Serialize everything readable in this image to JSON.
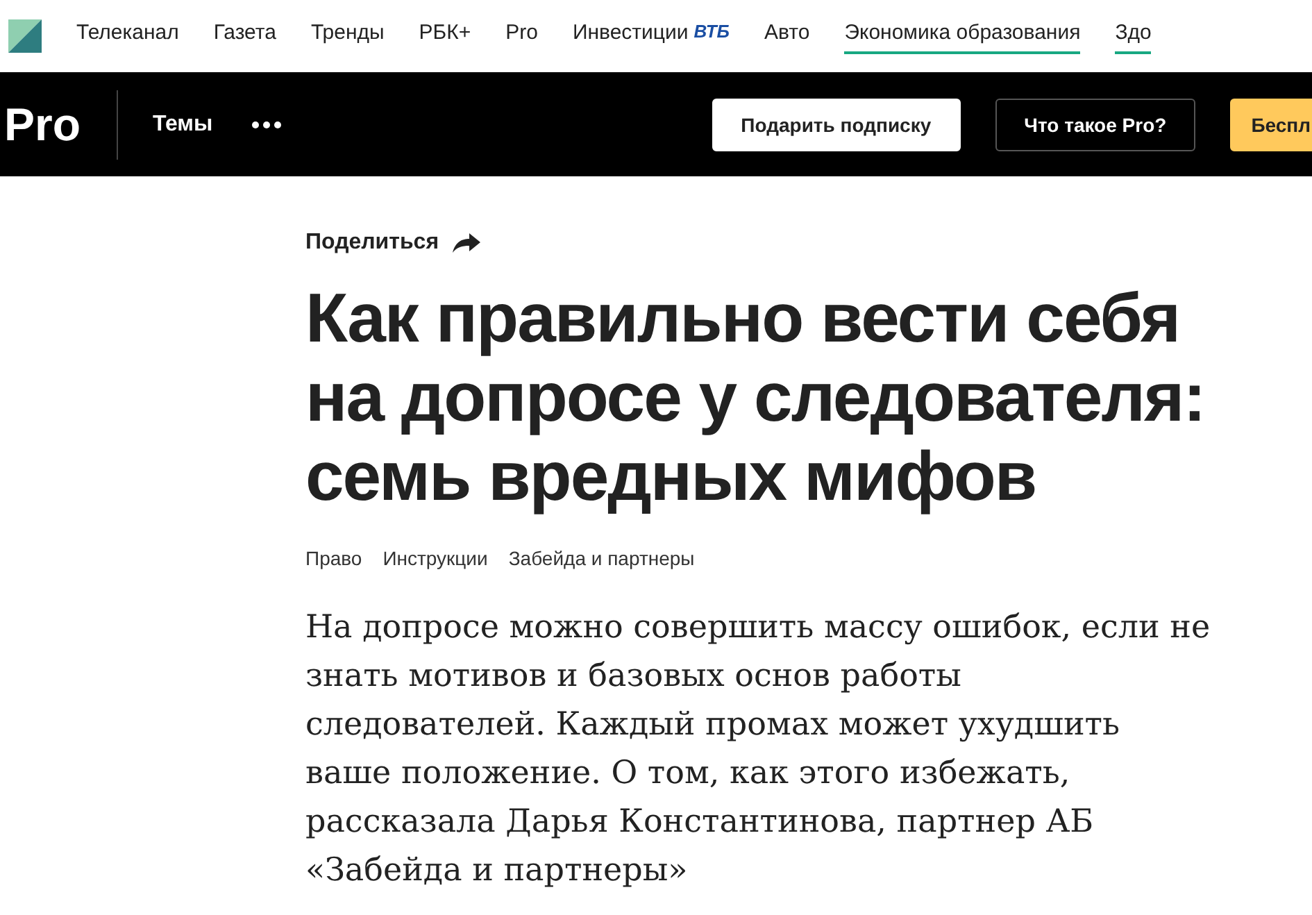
{
  "top_nav": {
    "items": [
      {
        "label": "Телеканал",
        "selected": false
      },
      {
        "label": "Газета",
        "selected": false
      },
      {
        "label": "Тренды",
        "selected": false
      },
      {
        "label": "РБК+",
        "selected": false
      },
      {
        "label": "Pro",
        "selected": false
      },
      {
        "label": "Инвестиции",
        "selected": false,
        "partner": "ВТБ"
      },
      {
        "label": "Авто",
        "selected": false
      },
      {
        "label": "Экономика образования",
        "selected": true
      },
      {
        "label": "Здо",
        "selected": true
      }
    ]
  },
  "pro_bar": {
    "logo": "Pro",
    "menu": "Темы",
    "buttons": [
      {
        "label": "Подарить подписку",
        "kind": "light"
      },
      {
        "label": "Что такое Pro?",
        "kind": "outline"
      },
      {
        "label": "Беспл",
        "kind": "accent"
      }
    ]
  },
  "article": {
    "share": "Поделиться",
    "title_lines": [
      "Как правильно вести себя",
      "на допросе у следователя:",
      "семь вредных мифов"
    ],
    "tags": [
      "Право",
      "Инструкции",
      "Забейда и партнеры"
    ],
    "lead_lines": [
      "На допросе можно совершить массу ошибок, если не",
      "знать мотивов и базовых основ работы",
      "следователей. Каждый промах может ухудшить",
      "ваше положение. О том, как этого избежать,",
      "рассказала Дарья Константинова, партнер АБ",
      "«Забейда и партнеры»"
    ]
  }
}
